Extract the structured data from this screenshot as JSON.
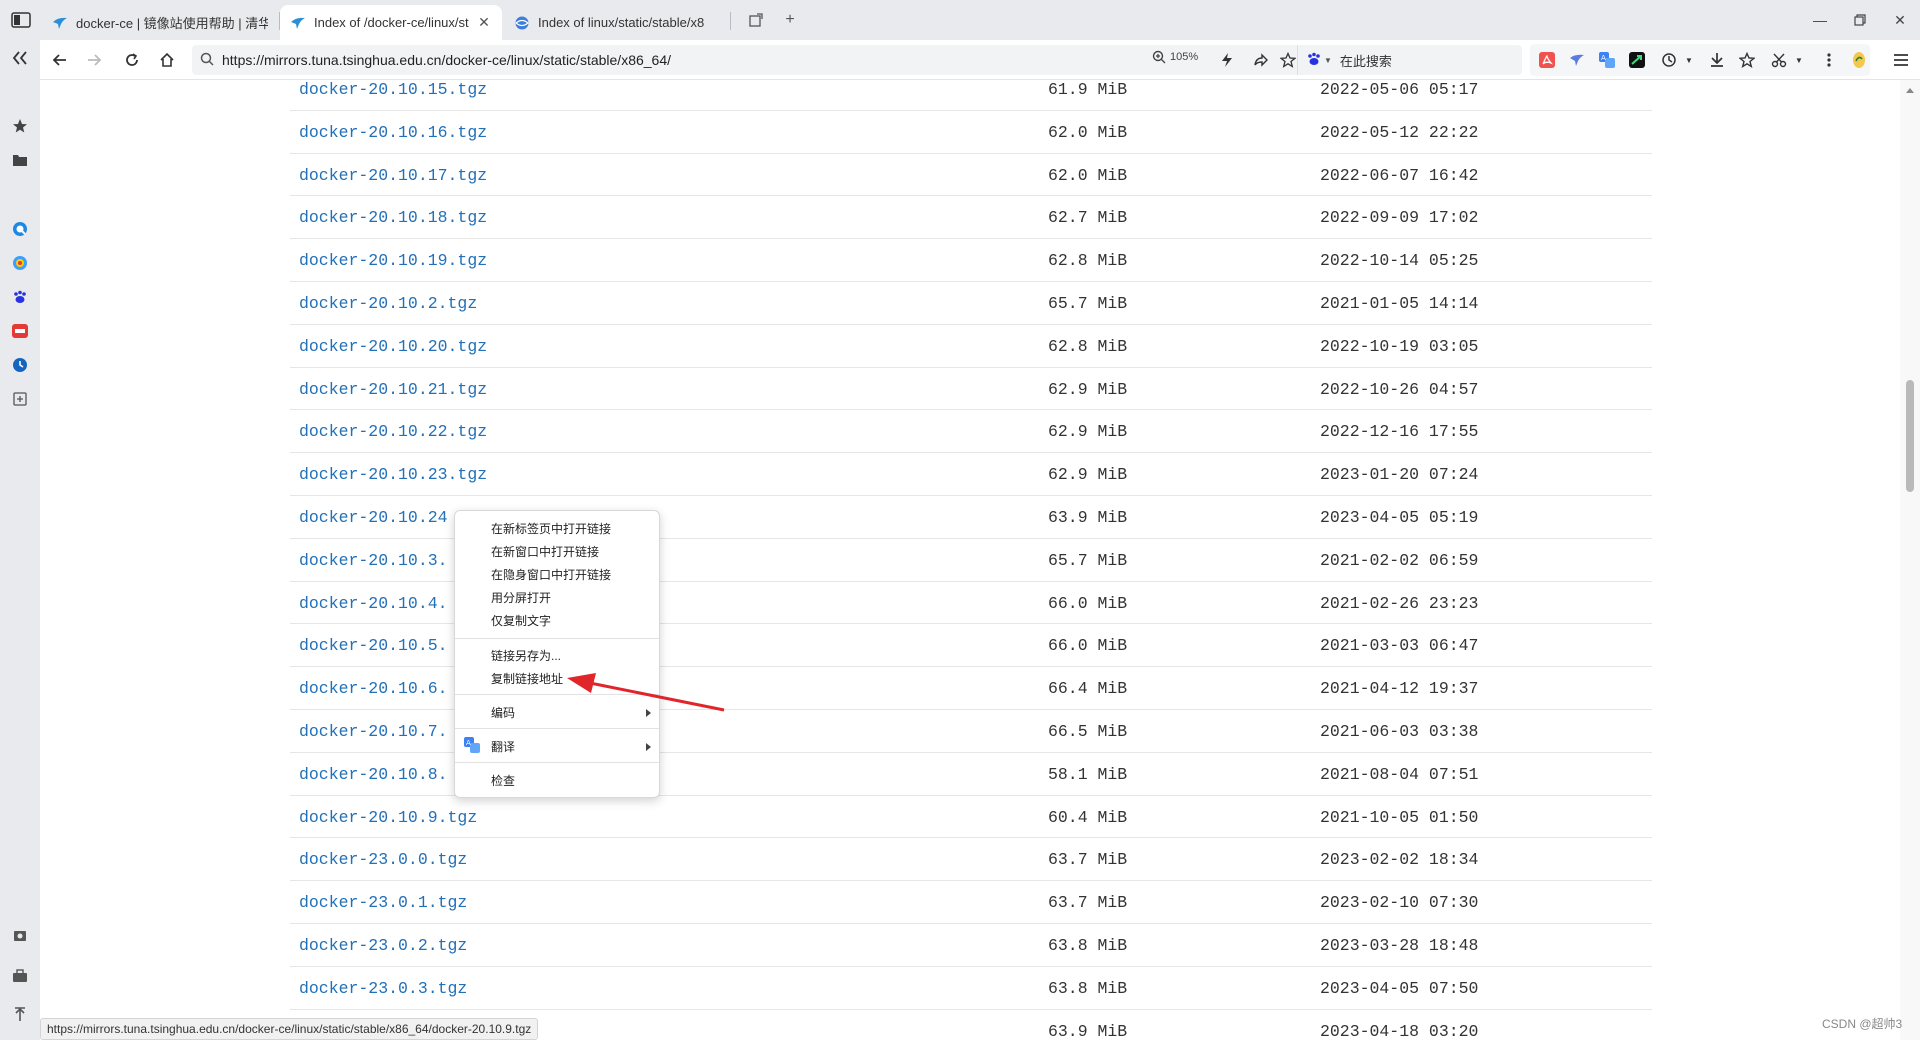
{
  "tabs": [
    {
      "label": "docker-ce | 镜像站使用帮助 | 清华",
      "active": false
    },
    {
      "label": "Index of /docker-ce/linux/st",
      "active": true
    },
    {
      "label": "Index of linux/static/stable/x8",
      "active": false
    }
  ],
  "toolbar": {
    "url": "https://mirrors.tuna.tsinghua.edu.cn/docker-ce/linux/static/stable/x86_64/",
    "zoom": "105%",
    "search_placeholder": "在此搜索"
  },
  "listing": {
    "rows": [
      {
        "name": "docker-20.10.15.tgz",
        "size": "61.9 MiB",
        "date": "2022-05-06 05:17"
      },
      {
        "name": "docker-20.10.16.tgz",
        "size": "62.0 MiB",
        "date": "2022-05-12 22:22"
      },
      {
        "name": "docker-20.10.17.tgz",
        "size": "62.0 MiB",
        "date": "2022-06-07 16:42"
      },
      {
        "name": "docker-20.10.18.tgz",
        "size": "62.7 MiB",
        "date": "2022-09-09 17:02"
      },
      {
        "name": "docker-20.10.19.tgz",
        "size": "62.8 MiB",
        "date": "2022-10-14 05:25"
      },
      {
        "name": "docker-20.10.2.tgz",
        "size": "65.7 MiB",
        "date": "2021-01-05 14:14"
      },
      {
        "name": "docker-20.10.20.tgz",
        "size": "62.8 MiB",
        "date": "2022-10-19 03:05"
      },
      {
        "name": "docker-20.10.21.tgz",
        "size": "62.9 MiB",
        "date": "2022-10-26 04:57"
      },
      {
        "name": "docker-20.10.22.tgz",
        "size": "62.9 MiB",
        "date": "2022-12-16 17:55"
      },
      {
        "name": "docker-20.10.23.tgz",
        "size": "62.9 MiB",
        "date": "2023-01-20 07:24"
      },
      {
        "name": "docker-20.10.24",
        "size": "63.9 MiB",
        "date": "2023-04-05 05:19"
      },
      {
        "name": "docker-20.10.3.",
        "size": "65.7 MiB",
        "date": "2021-02-02 06:59"
      },
      {
        "name": "docker-20.10.4.",
        "size": "66.0 MiB",
        "date": "2021-02-26 23:23"
      },
      {
        "name": "docker-20.10.5.",
        "size": "66.0 MiB",
        "date": "2021-03-03 06:47"
      },
      {
        "name": "docker-20.10.6.",
        "size": "66.4 MiB",
        "date": "2021-04-12 19:37"
      },
      {
        "name": "docker-20.10.7.",
        "size": "66.5 MiB",
        "date": "2021-06-03 03:38"
      },
      {
        "name": "docker-20.10.8.",
        "size": "58.1 MiB",
        "date": "2021-08-04 07:51"
      },
      {
        "name": "docker-20.10.9.tgz",
        "size": "60.4 MiB",
        "date": "2021-10-05 01:50"
      },
      {
        "name": "docker-23.0.0.tgz",
        "size": "63.7 MiB",
        "date": "2023-02-02 18:34"
      },
      {
        "name": "docker-23.0.1.tgz",
        "size": "63.7 MiB",
        "date": "2023-02-10 07:30"
      },
      {
        "name": "docker-23.0.2.tgz",
        "size": "63.8 MiB",
        "date": "2023-03-28 18:48"
      },
      {
        "name": "docker-23.0.3.tgz",
        "size": "63.8 MiB",
        "date": "2023-04-05 07:50"
      },
      {
        "name": "",
        "size": "63.9 MiB",
        "date": "2023-04-18 03:20"
      }
    ]
  },
  "context_menu": {
    "open_new_tab": "在新标签页中打开链接",
    "open_new_window": "在新窗口中打开链接",
    "open_incognito": "在隐身窗口中打开链接",
    "open_split": "用分屏打开",
    "copy_text": "仅复制文字",
    "save_link_as": "链接另存为...",
    "copy_link": "复制链接地址",
    "encoding": "编码",
    "translate": "翻译",
    "inspect": "检查"
  },
  "status": {
    "hover_url": "https://mirrors.tuna.tsinghua.edu.cn/docker-ce/linux/static/stable/x86_64/docker-20.10.9.tgz",
    "watermark": "CSDN @超帅3"
  },
  "colors": {
    "link": "#2170b8",
    "annotation_arrow": "#e0262b"
  }
}
